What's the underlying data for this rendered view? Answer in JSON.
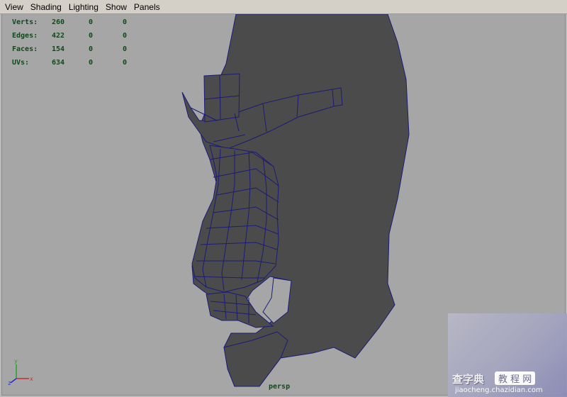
{
  "menu": [
    "View",
    "Shading",
    "Lighting",
    "Show",
    "Panels"
  ],
  "hud": {
    "rows": [
      {
        "label": "Verts:",
        "values": [
          "260",
          "0",
          "0"
        ]
      },
      {
        "label": "Edges:",
        "values": [
          "422",
          "0",
          "0"
        ]
      },
      {
        "label": "Faces:",
        "values": [
          "154",
          "0",
          "0"
        ]
      },
      {
        "label": "UVs:",
        "values": [
          "634",
          "0",
          "0"
        ]
      }
    ]
  },
  "camera_label": "persp",
  "axis": {
    "x": "x",
    "y": "y",
    "z": "z"
  },
  "watermark": {
    "brand": "查字典",
    "tag": "教 程 网",
    "url": "jiaocheng.chazidian.com"
  },
  "colors": {
    "viewport_bg": "#a6a6a6",
    "mesh_fill": "#4b4b4b",
    "wire": "#1b1b78",
    "hud_text": "#0f4a1a"
  }
}
